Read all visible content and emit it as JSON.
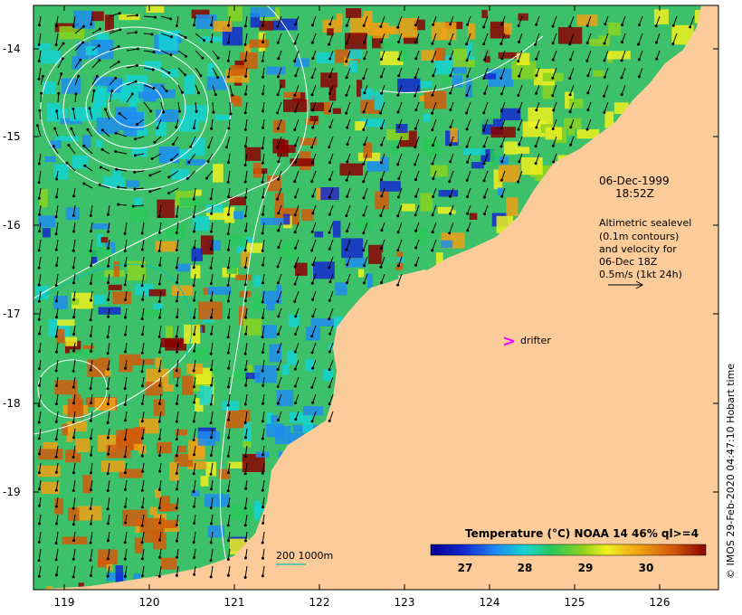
{
  "map": {
    "x_ticks": [
      "119",
      "120",
      "121",
      "122",
      "123",
      "124",
      "125",
      "126"
    ],
    "y_ticks": [
      "-14",
      "-15",
      "-16",
      "-17",
      "-18",
      "-19"
    ],
    "date": "06-Dec-1999",
    "time": "18:52Z",
    "legend_lines": [
      "Altimetric sealevel",
      "(0.1m contours)",
      "and velocity for",
      "06-Dec 18Z",
      "0.5m/s (1kt 24h)"
    ],
    "drifter_label": "drifter",
    "depth_label": "200  1000m",
    "colorbar": {
      "title": "Temperature (°C) NOAA 14 46% ql>=4",
      "ticks": [
        "27",
        "28",
        "29",
        "30"
      ]
    },
    "credit": "© IMOS 29-Feb-2020 04:47:10 Hobart time",
    "colors": {
      "land": "#fbcc9a",
      "drifter": "#ff00ff",
      "contour": "#ffffff",
      "depth_200": "#00c0c0"
    }
  }
}
